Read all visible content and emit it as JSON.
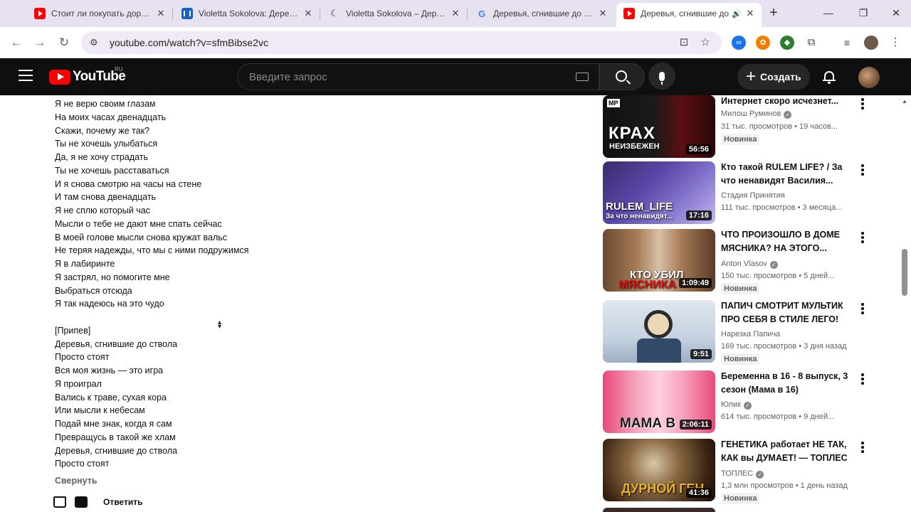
{
  "browser": {
    "tabs": [
      {
        "title": "Стоит ли покупать дорогой",
        "favicon": "youtube-icon"
      },
      {
        "title": "Violetta Sokolova: Деревья,",
        "favicon": "pause-icon"
      },
      {
        "title": "Violetta Sokolova – Деревья",
        "favicon": "moon-icon"
      },
      {
        "title": "Деревья, сгнившие до ство",
        "favicon": "google-icon"
      },
      {
        "title": "Деревья, сгнившие до",
        "favicon": "youtube-icon"
      }
    ],
    "url": "youtube.com/watch?v=sfmBibse2vc"
  },
  "youtube": {
    "logo": "YouTube",
    "region": "RU",
    "search_placeholder": "Введите запрос",
    "create_label": "Создать"
  },
  "description": {
    "lines": [
      "Я не верю своим глазам",
      "На моих часах двенадцать",
      "Скажи, почему же так?",
      "Ты не хочешь улыбаться",
      "Да, я не хочу страдать",
      "Ты не хочешь расставаться",
      "И я снова смотрю на часы на стене",
      "И там снова двенадцать",
      "Я не сплю который час",
      "Мысли о тебе не дают мне спать сейчас",
      "В моей голове мысли снова кружат вальс",
      "Не теряя надежды, что мы с ними подружимся",
      "Я в лабиринте",
      "Я застрял, но помогите мне",
      "Выбраться отсюда",
      "Я так надеюсь на это чудо",
      "",
      "[Припев]",
      "Деревья, сгнившие до ствола",
      "Просто стоят",
      "Вся моя жизнь — это игра",
      "Я проиграл",
      "Вались к траве, сухая кора",
      "Или мысли к небесам",
      "Подай мне знак, когда я сам",
      "Превращусь в такой же хлам",
      "Деревья, сгнившие до ствола",
      "Просто стоят"
    ],
    "collapse_label": "Свернуть",
    "reply_label": "Ответить"
  },
  "recommendations": [
    {
      "title": "Интернет скоро исчезнет...",
      "channel": "Милош Руминов",
      "verified": true,
      "stats": "31 тыс. просмотров • 19 часов...",
      "badge": "Новинка",
      "duration": "56:56",
      "thumb_caption": "КРАХ",
      "thumb_caption2": "НЕИЗБЕЖЕН",
      "thumb_tag": "MP"
    },
    {
      "title": "Кто такой RULEM LIFE? / За что ненавидят Василия...",
      "channel": "Стадия Принятия",
      "verified": false,
      "stats": "111 тыс. просмотров • 3 месяца...",
      "badge": "",
      "duration": "17:16",
      "thumb_caption": "RULEM_LIFE",
      "thumb_caption2": "За что ненавидят..."
    },
    {
      "title": "ЧТО ПРОИЗОШЛО В ДОМЕ МЯСНИКА? НА ЭТОГО...",
      "channel": "Anton Vlasov",
      "verified": true,
      "stats": "150 тыс. просмотров • 5 дней...",
      "badge": "Новинка",
      "duration": "1:09:49",
      "thumb_caption": "КТО УБИЛ",
      "thumb_caption2": "МЯСНИКА"
    },
    {
      "title": "ПАПИЧ СМОТРИТ МУЛЬТИК ПРО СЕБЯ В СТИЛЕ ЛЕГО!",
      "channel": "Нарезка Папича",
      "verified": false,
      "stats": "169 тыс. просмотров • 3 дня назад",
      "badge": "Новинка",
      "duration": "9:51"
    },
    {
      "title": "Беременна в 16 - 8 выпуск, 3 сезон (Мама в 16)",
      "channel": "Юлик",
      "verified": true,
      "stats": "614 тыс. просмотров • 9 дней...",
      "badge": "",
      "duration": "2:06:11",
      "thumb_caption": "МАМА В"
    },
    {
      "title": "ГЕНЕТИКА работает НЕ ТАК, КАК вы ДУМАЕТ! — ТОПЛЕС",
      "channel": "ТОПЛЕС",
      "verified": true,
      "stats": "1,3 млн просмотров • 1 день назад",
      "badge": "Новинка",
      "duration": "41:36",
      "thumb_caption": "ДУРНОЙ ГЕН"
    }
  ]
}
